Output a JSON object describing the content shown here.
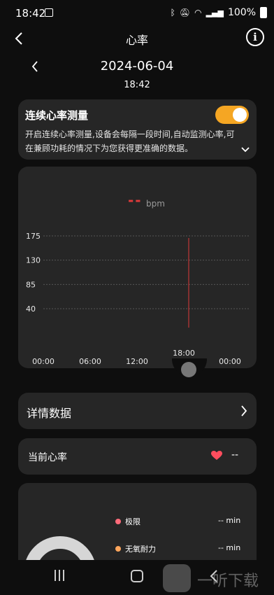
{
  "status_bar": {
    "time": "18:42",
    "battery": "100%"
  },
  "header": {
    "title": "心率"
  },
  "date_nav": {
    "date": "2024-06-04",
    "time": "18:42"
  },
  "continuous": {
    "title": "连续心率测量",
    "description": "开启连续心率测量,设备会每隔一段时间,自动监测心率,可在兼顾功耗的情况下为您获得更准确的数据。",
    "enabled": true,
    "accent_color": "#f5a623"
  },
  "chart": {
    "value_display": "--",
    "unit": "bpm",
    "cursor_label": "18:00",
    "accent_color": "#e03a3a"
  },
  "chart_data": {
    "type": "line",
    "y_ticks": [
      "175",
      "130",
      "85",
      "40"
    ],
    "x_ticks": [
      "00:00",
      "06:00",
      "12:00",
      "18:00",
      "00:00"
    ],
    "ylim": [
      40,
      175
    ],
    "series": [
      {
        "values": []
      }
    ]
  },
  "detail_row": {
    "label": "详情数据"
  },
  "current_hr": {
    "label": "当前心率",
    "value": "--",
    "heart_color": "#ff4d5e"
  },
  "zones": {
    "items": [
      {
        "label": "极限",
        "value": "-- min",
        "color": "#ff6b7a"
      },
      {
        "label": "无氧耐力",
        "value": "-- min",
        "color": "#ffa65c"
      }
    ]
  },
  "watermark": {
    "text": "一听下载"
  }
}
